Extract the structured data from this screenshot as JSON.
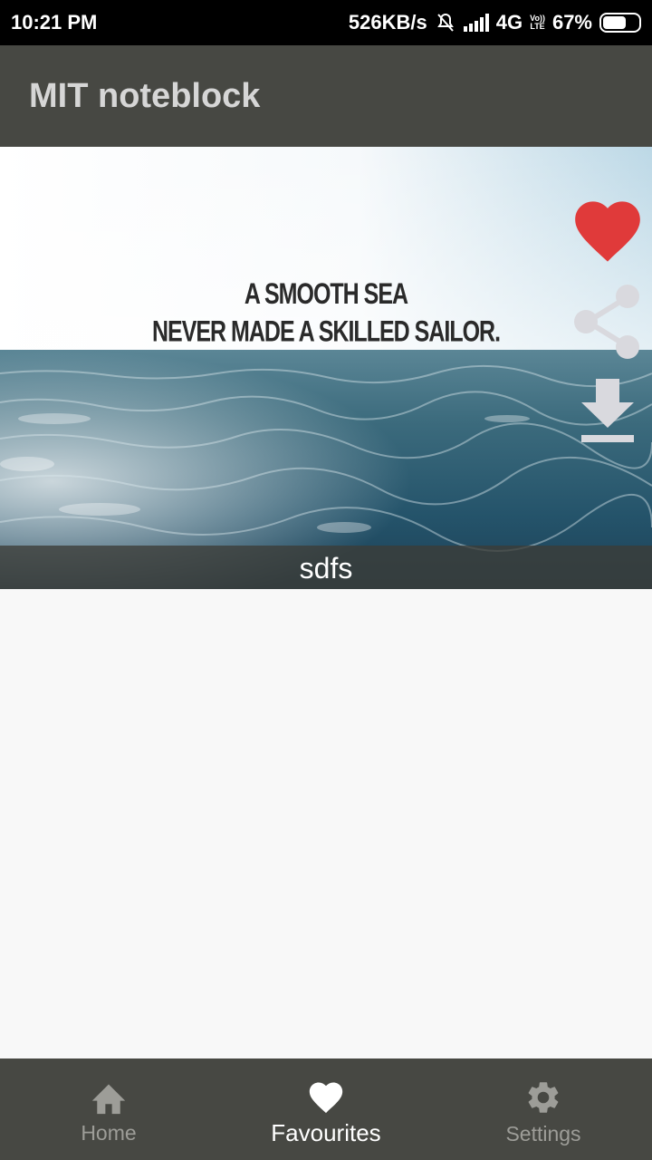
{
  "status_bar": {
    "time": "10:21 PM",
    "speed": "526KB/s",
    "network": "4G",
    "volte_top": "Vo))",
    "volte_bottom": "LTE",
    "battery_percent": "67%",
    "battery_level": 0.67
  },
  "app_bar": {
    "title": "MIT noteblock"
  },
  "card": {
    "quote_line1": "A SMOOTH SEA",
    "quote_line2": "NEVER MADE A SKILLED SAILOR.",
    "caption": "sdfs",
    "actions": {
      "favorite_icon": "heart-icon",
      "favorite_color": "#e03a3a",
      "share_icon": "share-icon",
      "download_icon": "download-icon"
    }
  },
  "bottom_nav": {
    "items": [
      {
        "label": "Home",
        "icon": "home-icon",
        "active": false
      },
      {
        "label": "Favourites",
        "icon": "heart-icon",
        "active": true
      },
      {
        "label": "Settings",
        "icon": "gear-icon",
        "active": false
      }
    ]
  },
  "colors": {
    "app_bar": "#474843",
    "background": "#f8f8f8",
    "inactive_nav": "#9d9d98",
    "active_nav": "#ffffff"
  }
}
